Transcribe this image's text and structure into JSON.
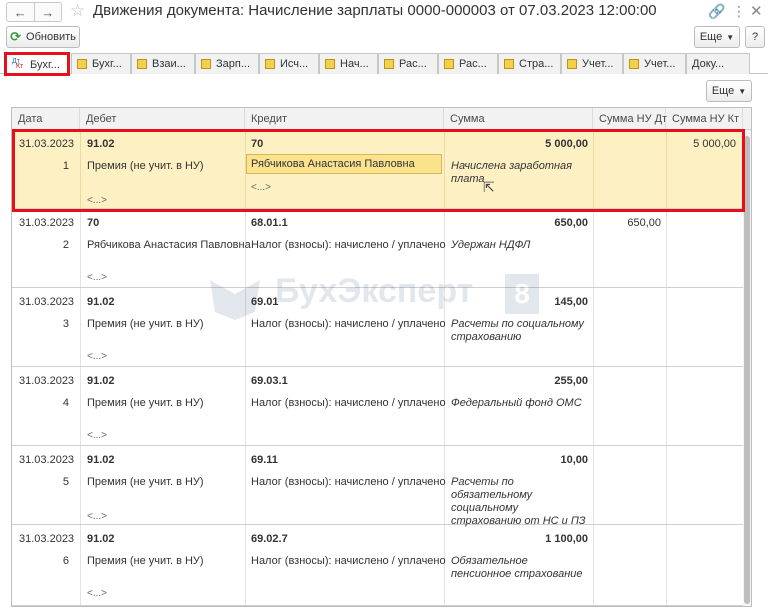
{
  "window": {
    "title": "Движения документа: Начисление зарплаты 0000-000003 от 07.03.2023 12:00:00"
  },
  "toolbar": {
    "refresh_label": "Обновить",
    "more_label": "Еще",
    "help_label": "?"
  },
  "tabs": [
    {
      "label": "Бухг...",
      "icon": "dt-kt-icon",
      "active": true
    },
    {
      "label": "Бухг...",
      "icon": "register-icon"
    },
    {
      "label": "Взаи...",
      "icon": "register-icon"
    },
    {
      "label": "Зарп...",
      "icon": "register-icon"
    },
    {
      "label": "Исч...",
      "icon": "register-icon"
    },
    {
      "label": "Нач...",
      "icon": "register-icon"
    },
    {
      "label": "Рас...",
      "icon": "register-icon"
    },
    {
      "label": "Рас...",
      "icon": "register-icon"
    },
    {
      "label": "Стра...",
      "icon": "register-icon"
    },
    {
      "label": "Учет...",
      "icon": "register-icon"
    },
    {
      "label": "Учет...",
      "icon": "register-icon"
    },
    {
      "label": "Доку...",
      "icon": "table-icon"
    }
  ],
  "table": {
    "more_label": "Еще",
    "columns": [
      "Дата",
      "Дебет",
      "Кредит",
      "Сумма",
      "Сумма НУ Дт",
      "Сумма НУ Кт"
    ],
    "rows": [
      {
        "date": "31.03.2023",
        "num": "1",
        "debit_account": "91.02",
        "debit_sub1": "Премия (не учит. в НУ)",
        "debit_sub2": "<...>",
        "credit_account": "70",
        "credit_sub1": "Рябчикова Анастасия Павловна",
        "credit_sub2": "<...>",
        "amount": "5 000,00",
        "content": "Начислена заработная плата",
        "nu_dt": "",
        "nu_kt": "5 000,00"
      },
      {
        "date": "31.03.2023",
        "num": "2",
        "debit_account": "70",
        "debit_sub1": "Рябчикова Анастасия Павловна",
        "debit_sub2": "<...>",
        "credit_account": "68.01.1",
        "credit_sub1": "Налог (взносы): начислено / уплачено",
        "credit_sub2": "",
        "amount": "650,00",
        "content": "Удержан НДФЛ",
        "nu_dt": "650,00",
        "nu_kt": ""
      },
      {
        "date": "31.03.2023",
        "num": "3",
        "debit_account": "91.02",
        "debit_sub1": "Премия (не учит. в НУ)",
        "debit_sub2": "<...>",
        "credit_account": "69.01",
        "credit_sub1": "Налог (взносы): начислено / уплачено",
        "credit_sub2": "",
        "amount": "145,00",
        "content": "Расчеты по социальному страхованию",
        "nu_dt": "",
        "nu_kt": ""
      },
      {
        "date": "31.03.2023",
        "num": "4",
        "debit_account": "91.02",
        "debit_sub1": "Премия (не учит. в НУ)",
        "debit_sub2": "<...>",
        "credit_account": "69.03.1",
        "credit_sub1": "Налог (взносы): начислено / уплачено",
        "credit_sub2": "",
        "amount": "255,00",
        "content": "Федеральный фонд ОМС",
        "nu_dt": "",
        "nu_kt": ""
      },
      {
        "date": "31.03.2023",
        "num": "5",
        "debit_account": "91.02",
        "debit_sub1": "Премия (не учит. в НУ)",
        "debit_sub2": "<...>",
        "credit_account": "69.11",
        "credit_sub1": "Налог (взносы): начислено / уплачено",
        "credit_sub2": "",
        "amount": "10,00",
        "content": "Расчеты по обязательному социальному страхованию от НС и ПЗ",
        "nu_dt": "",
        "nu_kt": ""
      },
      {
        "date": "31.03.2023",
        "num": "6",
        "debit_account": "91.02",
        "debit_sub1": "Премия (не учит. в НУ)",
        "debit_sub2": "<...>",
        "credit_account": "69.02.7",
        "credit_sub1": "Налог (взносы): начислено / уплачено",
        "credit_sub2": "",
        "amount": "1 100,00",
        "content": "Обязательное пенсионное страхование",
        "nu_dt": "",
        "nu_kt": ""
      }
    ]
  },
  "watermark": {
    "text": "БухЭксперт",
    "badge": "8"
  }
}
